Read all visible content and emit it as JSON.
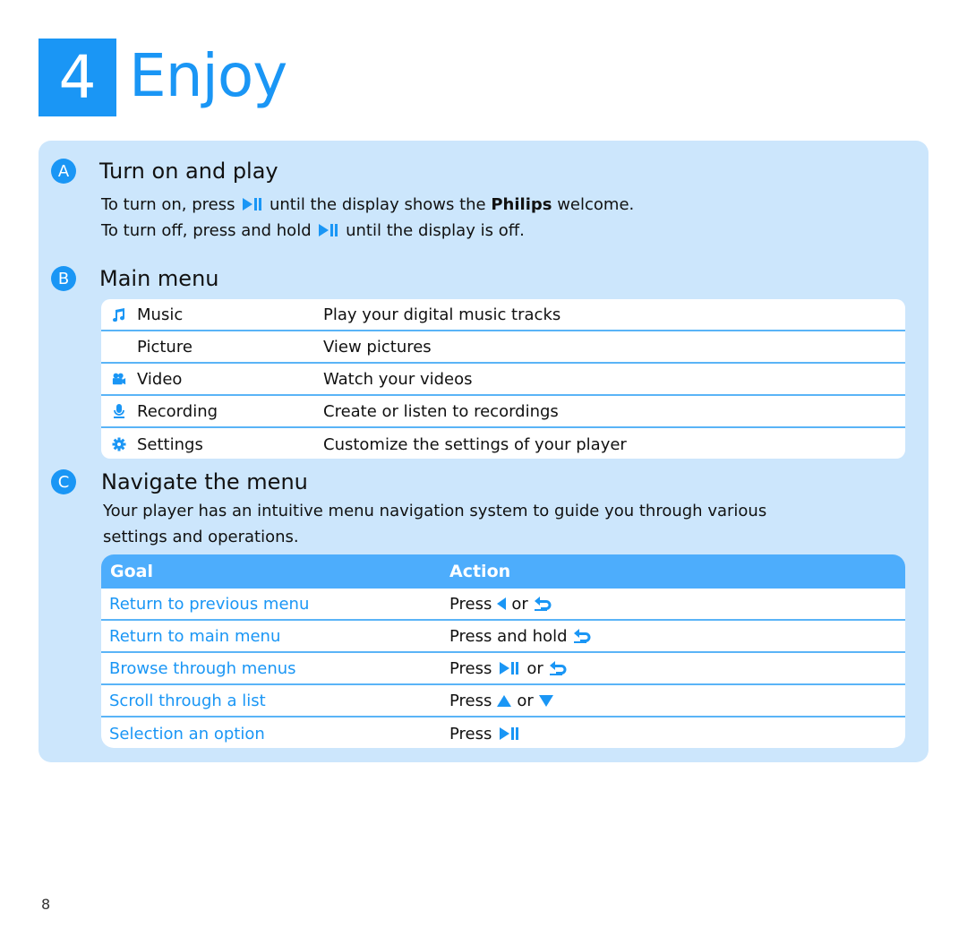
{
  "header": {
    "number": "4",
    "title": "Enjoy"
  },
  "colors": {
    "accent": "#1a96f5",
    "panel_bg": "#cce6fc",
    "table_header_bg": "#4dadfc",
    "row_divider": "#5ab4f7"
  },
  "section_a": {
    "badge": "A",
    "title": "Turn on and play",
    "line1_pre": "To turn on, press",
    "line1_mid": "until the display shows the",
    "line1_bold": "Philips",
    "line1_post": "welcome.",
    "line2_pre": "To turn off, press and hold",
    "line2_post": "until the display is off."
  },
  "section_b": {
    "badge": "B",
    "title": "Main menu",
    "items": [
      {
        "icon": "music-note-icon",
        "name": "Music",
        "description": "Play your digital music tracks"
      },
      {
        "icon": "",
        "name": "Picture",
        "description": "View pictures"
      },
      {
        "icon": "video-camera-icon",
        "name": "Video",
        "description": "Watch your videos"
      },
      {
        "icon": "microphone-icon",
        "name": "Recording",
        "description": "Create or listen to recordings"
      },
      {
        "icon": "gear-icon",
        "name": "Settings",
        "description": "Customize the settings of your player"
      }
    ]
  },
  "section_c": {
    "badge": "C",
    "title": "Navigate the menu",
    "intro_line1": "Your player has an intuitive menu navigation system to guide you through various",
    "intro_line2": "settings and operations.",
    "table": {
      "headers": {
        "goal": "Goal",
        "action": "Action"
      },
      "rows": [
        {
          "goal": "Return to previous menu",
          "press": "Press",
          "or": "or",
          "buttons": [
            "left-arrow",
            "back"
          ]
        },
        {
          "goal": "Return to main menu",
          "press": "Press and hold",
          "or": "",
          "buttons": [
            "back"
          ]
        },
        {
          "goal": "Browse through menus",
          "press": "Press",
          "or": "or",
          "buttons": [
            "play-pause",
            "back"
          ]
        },
        {
          "goal": "Scroll through a list",
          "press": "Press",
          "or": "or",
          "buttons": [
            "up-arrow",
            "down-arrow"
          ]
        },
        {
          "goal": "Selection an option",
          "press": "Press",
          "or": "",
          "buttons": [
            "play-pause"
          ]
        }
      ]
    }
  },
  "footer": {
    "page_number": "8"
  }
}
